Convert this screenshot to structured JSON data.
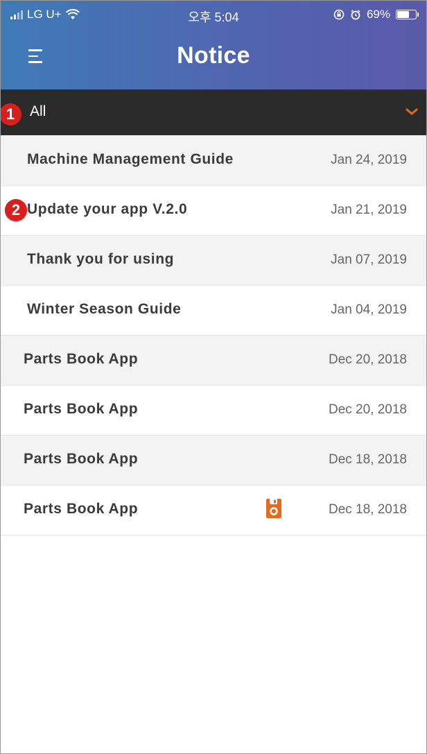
{
  "status_bar": {
    "carrier": "LG U+",
    "time": "오후 5:04",
    "battery": "69%",
    "battery_fill_fraction": 0.69
  },
  "header": {
    "title": "Notice",
    "menu_icon": "hamburger-menu-icon"
  },
  "filter": {
    "selected": "All",
    "chevron_icon": "chevron-down-icon",
    "accent_color": "#e8681f"
  },
  "annotations": [
    {
      "label": "1"
    },
    {
      "label": "2"
    }
  ],
  "notices": [
    {
      "title": "Machine Management Guide",
      "date": "Jan 24, 2019",
      "has_attachment": false
    },
    {
      "title": "Update your app V.2.0",
      "date": "Jan 21, 2019",
      "has_attachment": false
    },
    {
      "title": "Thank you for using",
      "date": "Jan 07, 2019",
      "has_attachment": false
    },
    {
      "title": "Winter Season Guide",
      "date": "Jan 04, 2019",
      "has_attachment": false
    },
    {
      "title": "Parts Book App",
      "date": "Dec 20, 2018",
      "has_attachment": false
    },
    {
      "title": "Parts Book App",
      "date": "Dec 20, 2018",
      "has_attachment": false
    },
    {
      "title": "Parts Book App",
      "date": "Dec 18, 2018",
      "has_attachment": false
    },
    {
      "title": "Parts Book App",
      "date": "Dec 18, 2018",
      "has_attachment": true,
      "attachment_icon": "save-file-icon"
    }
  ],
  "colors": {
    "header_gradient_start": "#3f7bb6",
    "header_gradient_end": "#5a5aa8",
    "filter_bar": "#2b2b2b",
    "badge": "#d7201e"
  }
}
